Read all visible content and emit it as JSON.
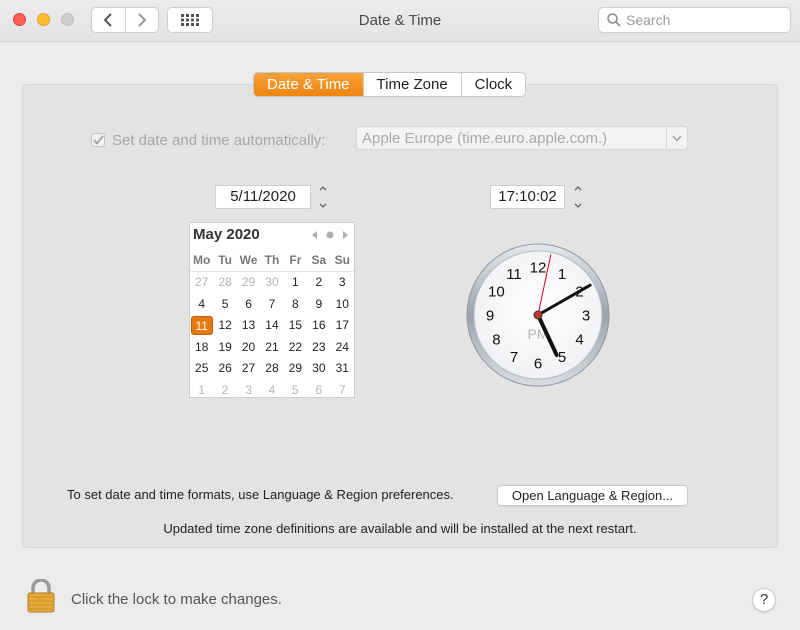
{
  "window": {
    "title": "Date & Time"
  },
  "search": {
    "placeholder": "Search"
  },
  "tabs": [
    {
      "label": "Date & Time",
      "active": true
    },
    {
      "label": "Time Zone",
      "active": false
    },
    {
      "label": "Clock",
      "active": false
    }
  ],
  "auto": {
    "checked": true,
    "label": "Set date and time automatically:",
    "server": "Apple Europe (time.euro.apple.com.)"
  },
  "date_field": "5/11/2020",
  "time_field": "17:10:02",
  "calendar": {
    "month_label": "May 2020",
    "weekdays": [
      "Mo",
      "Tu",
      "We",
      "Th",
      "Fr",
      "Sa",
      "Su"
    ],
    "weeks": [
      [
        "27",
        "28",
        "29",
        "30",
        "1",
        "2",
        "3"
      ],
      [
        "4",
        "5",
        "6",
        "7",
        "8",
        "9",
        "10"
      ],
      [
        "11",
        "12",
        "13",
        "14",
        "15",
        "16",
        "17"
      ],
      [
        "18",
        "19",
        "20",
        "21",
        "22",
        "23",
        "24"
      ],
      [
        "25",
        "26",
        "27",
        "28",
        "29",
        "30",
        "31"
      ],
      [
        "1",
        "2",
        "3",
        "4",
        "5",
        "6",
        "7"
      ]
    ],
    "muted_days": [
      [
        0,
        0
      ],
      [
        0,
        1
      ],
      [
        0,
        2
      ],
      [
        0,
        3
      ],
      [
        5,
        0
      ],
      [
        5,
        1
      ],
      [
        5,
        2
      ],
      [
        5,
        3
      ],
      [
        5,
        4
      ],
      [
        5,
        5
      ],
      [
        5,
        6
      ]
    ],
    "selected": [
      2,
      0
    ]
  },
  "clock": {
    "numerals": [
      "12",
      "1",
      "2",
      "3",
      "4",
      "5",
      "6",
      "7",
      "8",
      "9",
      "10",
      "11"
    ],
    "period": "PM",
    "hour": 5,
    "minute": 10,
    "second": 2
  },
  "formats_text": "To set date and time formats, use Language & Region preferences.",
  "lang_button": "Open Language & Region...",
  "updated_text": "Updated time zone definitions are available and will be installed at the next restart.",
  "lock_text": "Click the lock to make changes.",
  "help_label": "?",
  "colors": {
    "accent": "#ef8510",
    "selected_day": "#e8790f",
    "second_hand": "#d0021b",
    "close": "#fe5f57",
    "minimize": "#febc2e"
  }
}
